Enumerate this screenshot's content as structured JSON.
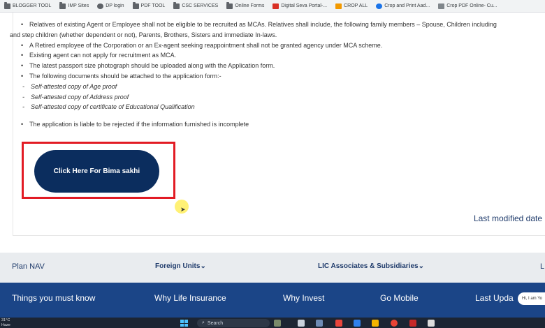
{
  "bookmarks": [
    {
      "label": "BLOGGER TOOL",
      "icon": "folder-icon"
    },
    {
      "label": "IMP Sites",
      "icon": "folder-icon"
    },
    {
      "label": "DP login",
      "icon": "globe-icon"
    },
    {
      "label": "PDF TOOL",
      "icon": "folder-icon"
    },
    {
      "label": "CSC SERVICES",
      "icon": "folder-icon"
    },
    {
      "label": "Online Forms",
      "icon": "folder-icon"
    },
    {
      "label": "Digital Seva Portal-...",
      "icon": "favicon-red"
    },
    {
      "label": "CROP ALL",
      "icon": "favicon-orange"
    },
    {
      "label": "Crop and Print Aad...",
      "icon": "favicon-blue"
    },
    {
      "label": "Crop PDF Online- Cu...",
      "icon": "favicon-gray"
    }
  ],
  "rules": [
    {
      "text": "Relatives of existing Agent or Employee shall not be eligible to be recruited as MCAs. Relatives shall include, the following family members – Spouse, Children including",
      "kind": "bullet"
    },
    {
      "text": "and step children (whether dependent or not), Parents, Brothers, Sisters and immediate In-laws.",
      "kind": "cont"
    },
    {
      "text": "A Retired employee of the Corporation or an Ex-agent seeking reappointment shall not be granted agency under MCA scheme.",
      "kind": "bullet"
    },
    {
      "text": "Existing agent can not apply for recruitment as MCA.",
      "kind": "bullet"
    },
    {
      "text": "The latest passport size photograph should be uploaded along with the Application form.",
      "kind": "bullet"
    },
    {
      "text": "The following documents should be attached to the application form:-",
      "kind": "bullet"
    },
    {
      "text": "Self-attested copy of Age proof",
      "kind": "sub"
    },
    {
      "text": "Self-attested copy of Address proof",
      "kind": "sub"
    },
    {
      "text": "Self-attested copy of certificate of Educational Qualification",
      "kind": "sub"
    },
    {
      "text": "The application is liable to be rejected if the information furnished is incomplete",
      "kind": "bullet-gap"
    }
  ],
  "cta": {
    "label": "Click Here For Bima sakhi",
    "highlight_color": "#e21b24",
    "button_color": "#0b2d5e"
  },
  "last_modified": "Last modified date",
  "footer_top": {
    "plan_nav": "Plan NAV",
    "foreign_units": "Foreign Units",
    "lic_associates": "LIC Associates & Subsidiaries",
    "cut_item": "L"
  },
  "footer_bottom": {
    "things": "Things you must know",
    "why_life": "Why Life Insurance",
    "why_invest": "Why Invest",
    "go_mobile": "Go Mobile",
    "last_updated": "Last Upda"
  },
  "chat_pill": "Hi, I am Yo",
  "taskbar": {
    "weather_line1": "31°C",
    "weather_line2": "Haze",
    "search_placeholder": "Search"
  },
  "colors": {
    "nav_dark": "#1b4587",
    "nav_light": "#e9ecef",
    "text_blue": "#1f3b6b"
  }
}
